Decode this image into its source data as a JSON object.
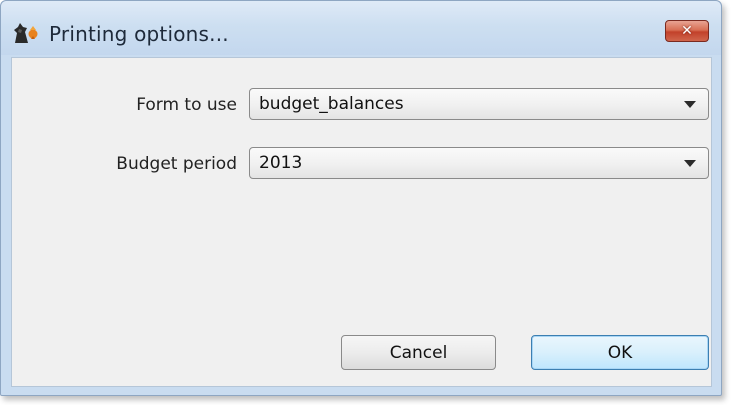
{
  "window": {
    "title": "Printing options...",
    "close_label": "✕"
  },
  "icons": {
    "app": "app-icon",
    "close": "close-icon",
    "dropdown": "chevron-down-icon"
  },
  "form": {
    "form_to_use_label": "Form to use",
    "form_to_use_value": "budget_balances",
    "budget_period_label": "Budget period",
    "budget_period_value": "2013"
  },
  "buttons": {
    "cancel_label": "Cancel",
    "ok_label": "OK"
  },
  "colors": {
    "close_button": "#c2412a",
    "default_button_border": "#3c7fb1",
    "titlebar": "#cddff1"
  }
}
